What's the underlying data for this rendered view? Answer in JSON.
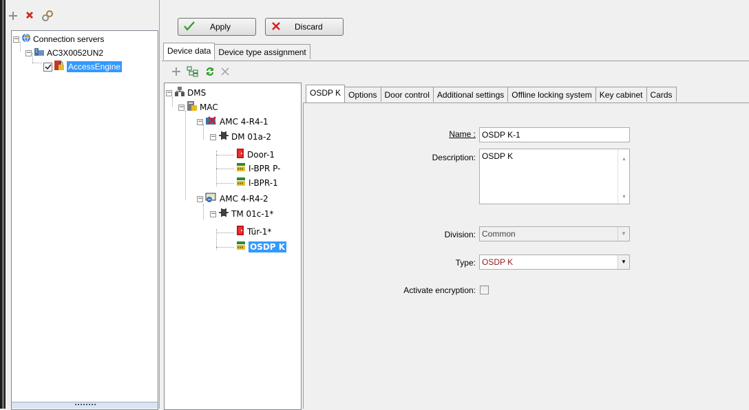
{
  "left_toolbar": {
    "add_icon": "plus-icon",
    "delete_icon": "x-icon",
    "connect_icon": "connect-icon"
  },
  "server_tree": [
    {
      "label": "Connection servers",
      "expander": "−",
      "icon": "globe-icon"
    },
    {
      "label": "AC3X0052UN2",
      "expander": "−",
      "icon": "server-icon"
    },
    {
      "label": "AccessEngine",
      "checked": true,
      "icon": "lock-icon",
      "selected": true
    }
  ],
  "top_buttons": {
    "apply": "Apply",
    "discard": "Discard"
  },
  "main_tabs": [
    "Device data",
    "Device type assignment"
  ],
  "device_tree": [
    {
      "label": "DMS",
      "expander": "−",
      "icon": "dms-icon"
    },
    {
      "label": "MAC",
      "expander": "−",
      "icon": "mac-icon"
    },
    {
      "label": "AMC 4-R4-1",
      "expander": "−",
      "icon": "amc-error-icon"
    },
    {
      "label": "DM 01a-2",
      "expander": "−",
      "icon": "door-model-icon"
    },
    {
      "label": "Door-1",
      "icon": "door-icon"
    },
    {
      "label": "I-BPR P-",
      "icon": "reader-icon"
    },
    {
      "label": "I-BPR-1",
      "icon": "reader-icon"
    },
    {
      "label": "AMC 4-R4-2",
      "expander": "−",
      "icon": "amc-icon"
    },
    {
      "label": "TM 01c-1*",
      "expander": "−",
      "icon": "door-model-icon"
    },
    {
      "label": "Tür-1*",
      "icon": "door-icon"
    },
    {
      "label": "OSDP K",
      "icon": "reader-icon",
      "selected": true
    }
  ],
  "prop_tabs": [
    "OSDP K",
    "Options",
    "Door control",
    "Additional settings",
    "Offline locking system",
    "Key cabinet",
    "Cards"
  ],
  "form": {
    "name_label": "Name :",
    "name_value": "OSDP K-1",
    "description_label": "Description:",
    "description_value": "OSDP K",
    "division_label": "Division:",
    "division_value": "Common",
    "type_label": "Type:",
    "type_value": "OSDP K",
    "type_color": "#8b1a1a",
    "encryption_label": "Activate encryption:",
    "encryption_checked": false
  },
  "colors": {
    "selection": "#3399ff",
    "apply_check": "#2e9b1f",
    "discard_x": "#d61f1f"
  }
}
